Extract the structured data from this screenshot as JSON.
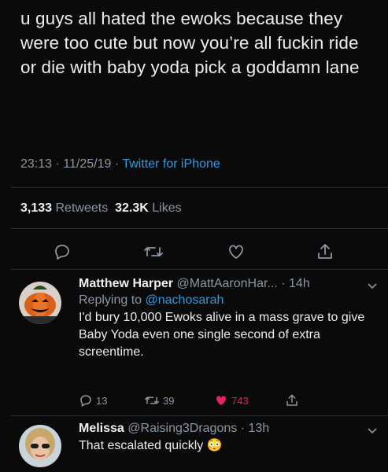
{
  "tweet": {
    "text": "u guys all hated the ewoks because they were too cute but now you’re all fuckin ride or die with baby yoda pick a goddamn lane",
    "time": "23:13",
    "date": "11/25/19",
    "source": "Twitter for iPhone",
    "sep": "·",
    "retweets_count": "3,133",
    "retweets_label": "Retweets",
    "likes_count": "32.3K",
    "likes_label": "Likes"
  },
  "replies": [
    {
      "name": "Matthew Harper",
      "handle": "@MattAaronHar...",
      "sep": "·",
      "age": "14h",
      "replying_prefix": "Replying to",
      "replying_to": "@nachosarah",
      "text": "I'd bury 10,000 Ewoks alive in a mass grave to give Baby Yoda even one single second of extra screentime.",
      "reply_count": "13",
      "retweet_count": "39",
      "like_count": "743"
    },
    {
      "name": "Melissa",
      "handle": "@Raising3Dragons",
      "sep": "·",
      "age": "13h",
      "text": "That escalated quickly",
      "emoji": "😳"
    }
  ],
  "colors": {
    "background": "#0a0a0a",
    "link": "#2f9ae0",
    "muted": "#8b96a3",
    "like": "#e0245e"
  },
  "icons": [
    "reply-icon",
    "retweet-icon",
    "like-icon",
    "share-icon",
    "chevron-down-icon"
  ]
}
